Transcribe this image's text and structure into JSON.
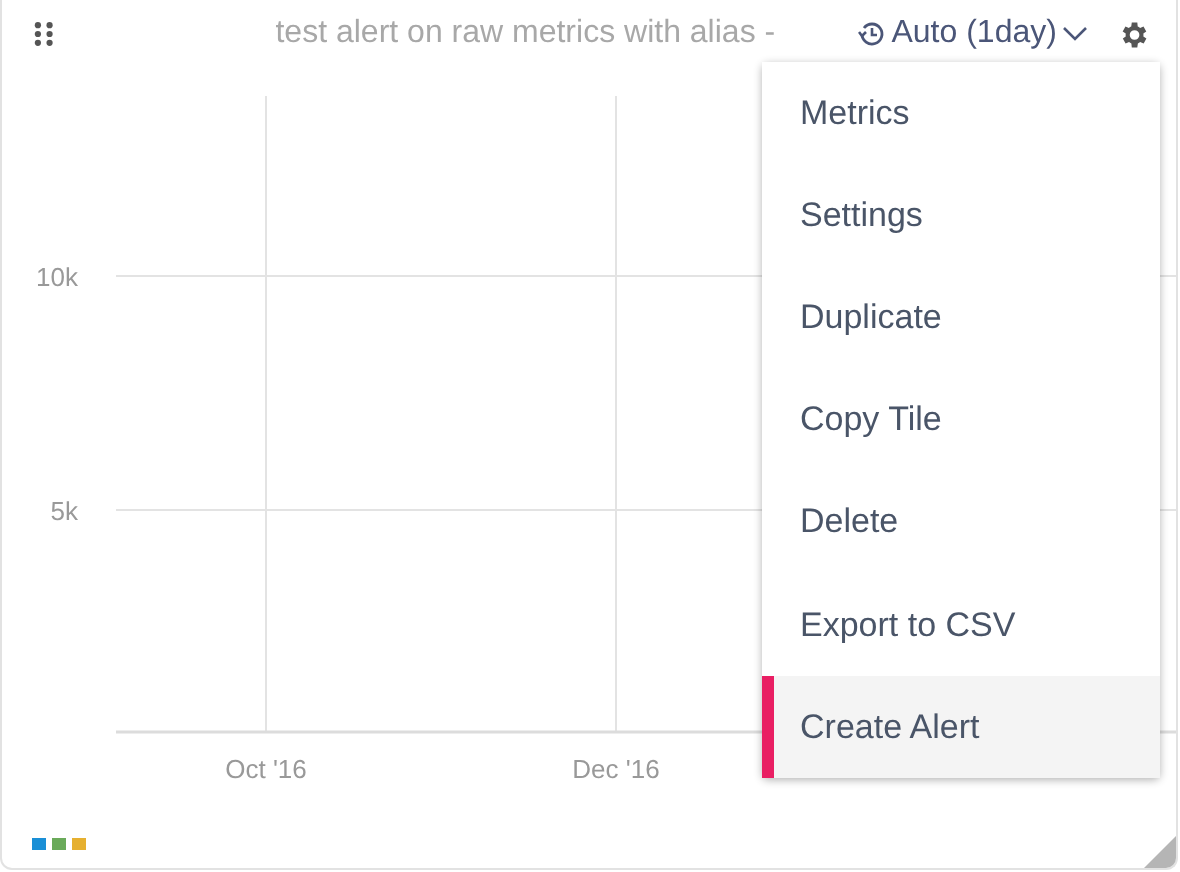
{
  "tile": {
    "title": "test alert on raw metrics with alias -",
    "time_range": "Auto (1day)"
  },
  "chart": {
    "y_ticks": [
      "10k",
      "5k"
    ],
    "x_ticks": [
      "Oct '16",
      "Dec '16"
    ]
  },
  "legend": [
    {
      "color": "#1a8fd6"
    },
    {
      "color": "#6aaa5a"
    },
    {
      "color": "#e6b030"
    }
  ],
  "menu": [
    {
      "label": "Metrics",
      "selected": false
    },
    {
      "label": "Settings",
      "selected": false
    },
    {
      "label": "Duplicate",
      "selected": false
    },
    {
      "label": "Copy Tile",
      "selected": false
    },
    {
      "label": "Delete",
      "selected": false
    },
    {
      "label": "Export to CSV",
      "selected": false
    },
    {
      "label": "Create Alert",
      "selected": true
    }
  ]
}
